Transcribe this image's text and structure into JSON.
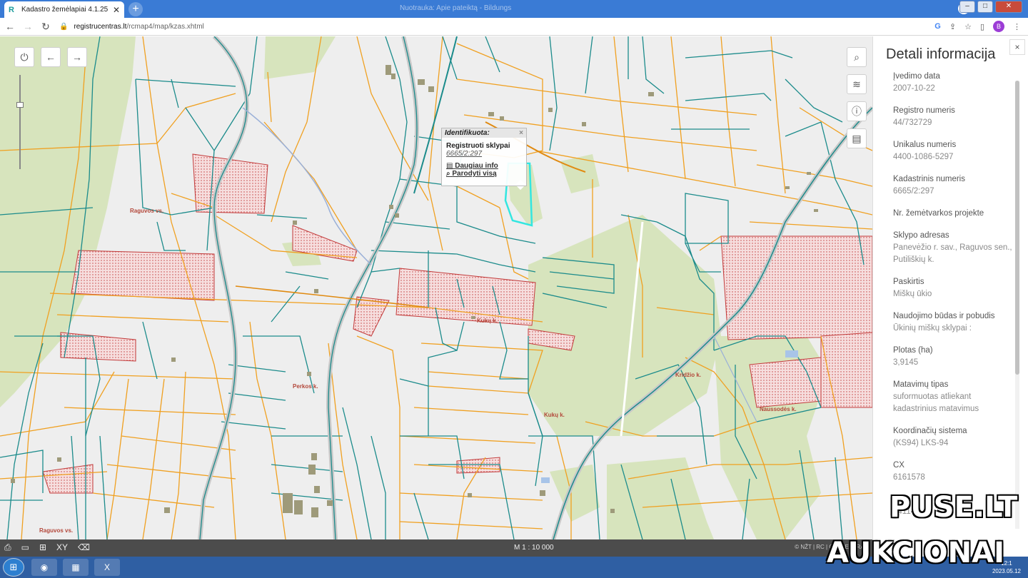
{
  "browser": {
    "tab_title": "Kadastro žemėlapiai 4.1.25",
    "tab_close": "✕",
    "new_tab": "+",
    "window_title": "Nuotrauka: Apie pateiktą - Bildungs",
    "url_host": "registrucentras.lt",
    "url_path": "/rcmap4/map/kzas.xhtml",
    "profile_initial": "B"
  },
  "map": {
    "popup": {
      "header": "Identifikuota:",
      "close": "×",
      "layer": "Registruoti sklypai",
      "parcel_id": "6665/2:297",
      "link_more": "Daugiau info",
      "link_show_all": "Parodyti visą"
    },
    "place_labels": {
      "raguvos_vs": "Raguvos vs.",
      "kuku": "Kukų k.",
      "kuku2": "Kukų k.",
      "kridzio": "Kridžio k.",
      "nausodes": "Naussodės k.",
      "perkos": "Perkos k.",
      "raguvos_vs2": "Raguvos vs."
    },
    "scale": "M 1 : 10 000",
    "credit": "© NŽT | RC | GIS-CENTRAS"
  },
  "panel": {
    "title": "Detali informacija",
    "close": "×",
    "fields": [
      {
        "label": "Įvedimo data",
        "value": "2007-10-22"
      },
      {
        "label": "Registro numeris",
        "value": "44/732729"
      },
      {
        "label": "Unikalus numeris",
        "value": "4400-1086-5297"
      },
      {
        "label": "Kadastrinis numeris",
        "value": "6665/2:297"
      },
      {
        "label": "Nr. žemėtvarkos projekte",
        "value": ""
      },
      {
        "label": "Sklypo adresas",
        "value": "Panevėžio r. sav., Raguvos sen., Putiliškių k."
      },
      {
        "label": "Paskirtis",
        "value": "Miškų ūkio"
      },
      {
        "label": "Naudojimo būdas ir pobudis",
        "value": "Ūkinių miškų sklypai :"
      },
      {
        "label": "Plotas (ha)",
        "value": "3,9145"
      },
      {
        "label": "Matavimų tipas",
        "value": "suformuotas atliekant kadastrinius matavimus"
      },
      {
        "label": "Koordinačių sistema",
        "value": "(KS94) LKS-94"
      },
      {
        "label": "CX",
        "value": "6161578"
      },
      {
        "label": "CY",
        "value": "541142"
      }
    ]
  },
  "taskbar": {
    "time": "12:1",
    "date": "2023.05.12"
  },
  "watermark": {
    "line1": "PUSE.LT",
    "line2": "AUKCIONAI"
  }
}
